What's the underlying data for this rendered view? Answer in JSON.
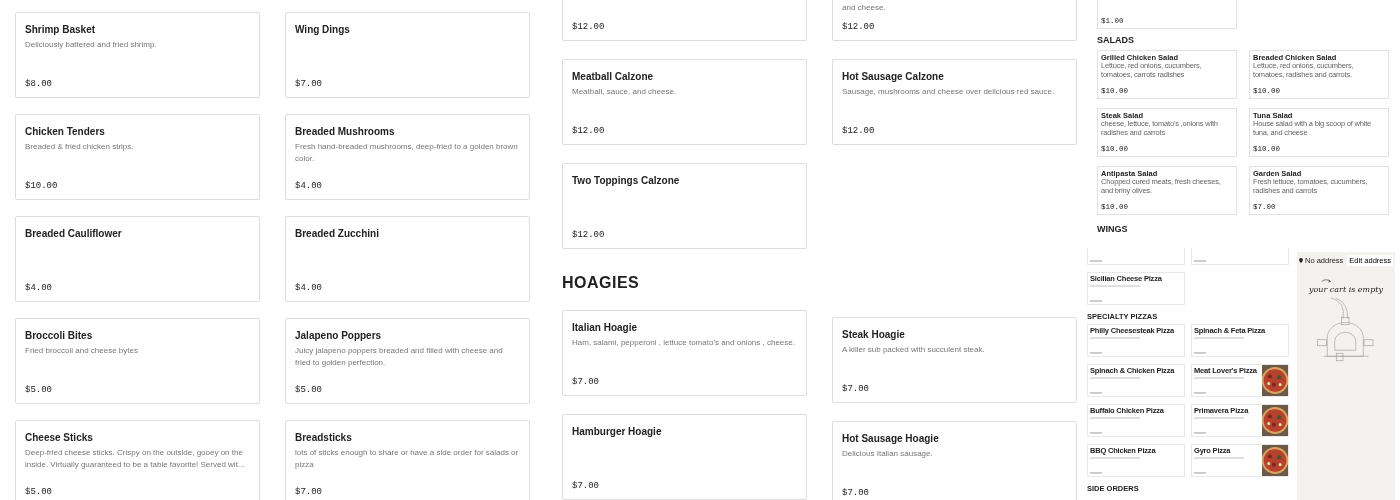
{
  "menu_columns": [
    {
      "items": [
        {
          "kind": "card",
          "name": "Shrimp Basket",
          "description": "Deliciously battered and fried shrimp.",
          "price": "$8.00"
        },
        {
          "kind": "card",
          "name": "Chicken Tenders",
          "description": "Breaded & fried chicken strips.",
          "price": "$10.00"
        },
        {
          "kind": "card",
          "name": "Breaded Cauliflower",
          "price": "$4.00"
        },
        {
          "kind": "card",
          "name": "Broccoli Bites",
          "description": "Fried broccoli and cheese bytes",
          "price": "$5.00"
        },
        {
          "kind": "card",
          "name": "Cheese Sticks",
          "description": "Deep-fried cheese sticks. Crispy on the outside, gooey on the inside. Virtually guaranteed to be a table favorite! Served wit...",
          "price": "$5.00"
        }
      ]
    },
    {
      "items": [
        {
          "kind": "card",
          "name": "Wing Dings",
          "price": "$7.00"
        },
        {
          "kind": "card",
          "name": "Breaded Mushrooms",
          "description": "Fresh hand-breaded mushrooms, deep-fried to a golden brown color.",
          "price": "$4.00"
        },
        {
          "kind": "card",
          "name": "Breaded Zucchini",
          "price": "$4.00"
        },
        {
          "kind": "card",
          "name": "Jalapeno Poppers",
          "description": "Juicy jalapeno poppers breaded and filled with cheese and fried to golden perfection.",
          "price": "$5.00"
        },
        {
          "kind": "card",
          "name": "Breadsticks",
          "description": "lots of sticks enough to share or have a side order for salads or pizza",
          "price": "$7.00"
        }
      ]
    },
    {
      "items": [
        {
          "kind": "card",
          "price": "$12.00"
        },
        {
          "kind": "card",
          "name": "Meatball Calzone",
          "description": "Meatball, sauce, and cheese.",
          "price": "$12.00"
        },
        {
          "kind": "card",
          "name": "Two Toppings Calzone",
          "price": "$12.00"
        },
        {
          "kind": "heading",
          "text": "HOAGIES"
        },
        {
          "kind": "card",
          "name": "Italian Hoagie",
          "description": "Ham, salami, pepperoni , lettuce tomato's and onions , cheese.",
          "price": "$7.00"
        },
        {
          "kind": "card",
          "name": "Hamburger Hoagie",
          "price": "$7.00"
        }
      ]
    },
    {
      "items": [
        {
          "kind": "card",
          "description": "and cheese.",
          "price": "$12.00"
        },
        {
          "kind": "card",
          "name": "Hot Sausage Calzone",
          "description": "Sausage, mushrooms and cheese over delicious red sauce.",
          "price": "$12.00"
        },
        {
          "kind": "spacer"
        },
        {
          "kind": "card",
          "name": "Steak Hoagie",
          "description": "A killer sub packed with succulent steak.",
          "price": "$7.00"
        },
        {
          "kind": "card",
          "name": "Hot Sausage Hoagie",
          "description": "Delicious Italian sausage.",
          "price": "$7.00"
        }
      ]
    }
  ],
  "salads_preview": {
    "items": [
      {
        "kind": "row",
        "cards": [
          {
            "price": "$1.00"
          }
        ]
      },
      {
        "kind": "heading",
        "text": "SALADS"
      },
      {
        "kind": "row",
        "cards": [
          {
            "name": "Grilled Chicken Salad",
            "description": "Lettuce, red onions, cucumbers, tomatoes, carrots radishes",
            "price": "$10.00"
          },
          {
            "name": "Breaded Chicken Salad",
            "description": "Lettuce, red onions, cucumbers, tomatoes, radishes and carrots.",
            "price": "$10.00"
          }
        ]
      },
      {
        "kind": "row",
        "cards": [
          {
            "name": "Steak Salad",
            "description": "cheese, lettuce, tomato's ,onions with radishes and carrots",
            "price": "$10.00"
          },
          {
            "name": "Tuna Salad",
            "description": "House salad with a big scoop of white tuna, and cheese",
            "price": "$10.00"
          }
        ]
      },
      {
        "kind": "row",
        "cards": [
          {
            "name": "Antipasta Salad",
            "description": "Chopped cured meats, fresh cheeses, and briny olives.",
            "price": "$10.00"
          },
          {
            "name": "Garden Salad",
            "description": "Fresh lettuce, tomatoes, cucumbers, radishes and carrots",
            "price": "$7.00"
          }
        ]
      },
      {
        "kind": "heading",
        "text": "WINGS"
      }
    ]
  },
  "pizza_preview": {
    "items": [
      {
        "kind": "row",
        "cards": [
          {
            "cut": true
          },
          {
            "cut": true
          }
        ]
      },
      {
        "kind": "row",
        "cards": [
          {
            "name": "Sicilian Cheese Pizza"
          }
        ]
      },
      {
        "kind": "heading",
        "text": "SPECIALTY PIZZAS"
      },
      {
        "kind": "row",
        "cards": [
          {
            "name": "Philly Cheesesteak Pizza"
          },
          {
            "name": "Spinach & Feta Pizza"
          }
        ]
      },
      {
        "kind": "row",
        "cards": [
          {
            "name": "Spinach & Chicken Pizza"
          },
          {
            "name": "Meat Lover's Pizza",
            "photo": true
          }
        ]
      },
      {
        "kind": "row",
        "cards": [
          {
            "name": "Buffalo Chicken Pizza"
          },
          {
            "name": "Primavera Pizza",
            "photo": true
          }
        ]
      },
      {
        "kind": "row",
        "cards": [
          {
            "name": "BBQ Chicken Pizza"
          },
          {
            "name": "Gyro Pizza",
            "photo": true
          }
        ]
      },
      {
        "kind": "heading",
        "text": "SIDE ORDERS"
      }
    ]
  },
  "cart": {
    "address": "No address",
    "edit": "Edit address",
    "message": "your cart is empty"
  }
}
